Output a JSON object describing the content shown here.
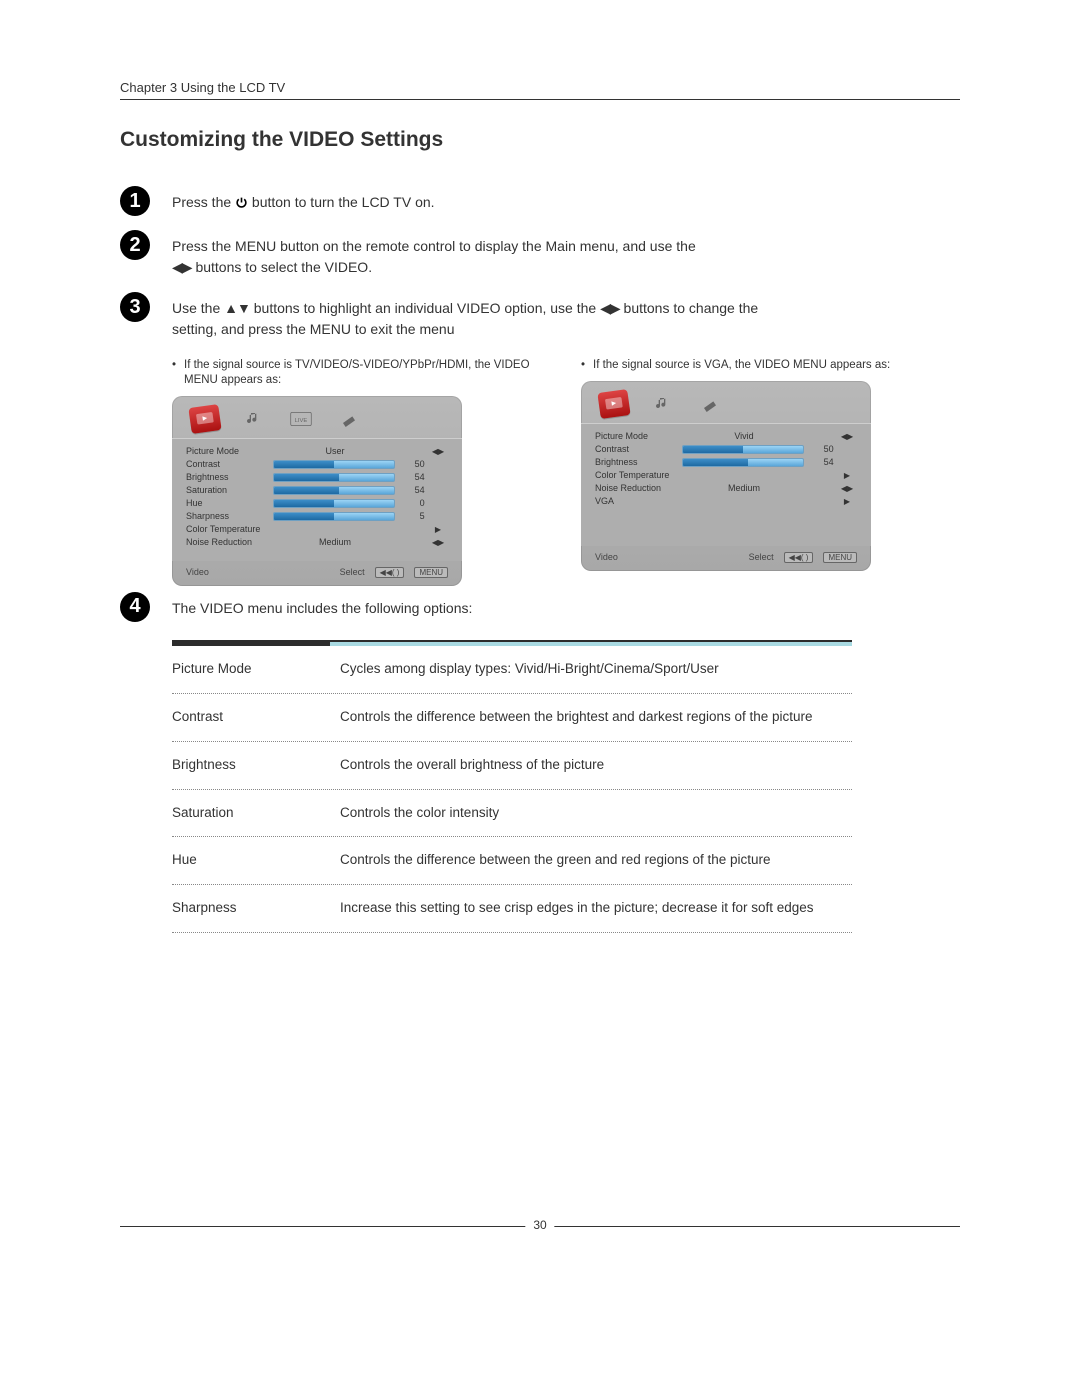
{
  "chapter_header": "Chapter 3 Using the LCD TV",
  "section_title": "Customizing the VIDEO Settings",
  "steps": {
    "s1_a": "Press the ",
    "s1_b": " button to turn the LCD TV on.",
    "s2_a": "Press the MENU button on the remote control to display the Main menu, and use the ",
    "s2_b": " buttons to select the VIDEO.",
    "s3_a": "Use the  ",
    "s3_b": " buttons to highlight an individual VIDEO option, use the ",
    "s3_c": " buttons to change the setting, and press the MENU to exit the menu",
    "s4": "The VIDEO menu includes the following options:"
  },
  "notes": {
    "left": "If the signal source is TV/VIDEO/S-VIDEO/YPbPr/HDMI, the VIDEO MENU appears as:",
    "right": "If the signal source is VGA, the VIDEO MENU appears as:"
  },
  "osd_left": {
    "rows": [
      {
        "label": "Picture Mode",
        "value": "User",
        "type": "text",
        "ind": "◀▶"
      },
      {
        "label": "Contrast",
        "value": "50",
        "type": "slider",
        "fill": 50,
        "ind": ""
      },
      {
        "label": "Brightness",
        "value": "54",
        "type": "slider",
        "fill": 54,
        "ind": ""
      },
      {
        "label": "Saturation",
        "value": "54",
        "type": "slider",
        "fill": 54,
        "ind": ""
      },
      {
        "label": "Hue",
        "value": "0",
        "type": "slider",
        "fill": 50,
        "ind": ""
      },
      {
        "label": "Sharpness",
        "value": "5",
        "type": "slider",
        "fill": 50,
        "ind": ""
      },
      {
        "label": "Color Temperature",
        "value": "",
        "type": "none",
        "ind": "▶"
      },
      {
        "label": "Noise Reduction",
        "value": "Medium",
        "type": "text",
        "ind": "◀▶"
      }
    ],
    "footer": {
      "left": "Video",
      "select": "Select",
      "center": "◀◀(  )",
      "menu": "MENU"
    }
  },
  "osd_right": {
    "rows": [
      {
        "label": "Picture Mode",
        "value": "Vivid",
        "type": "text",
        "ind": "◀▶"
      },
      {
        "label": "Contrast",
        "value": "50",
        "type": "slider",
        "fill": 50,
        "ind": ""
      },
      {
        "label": "Brightness",
        "value": "54",
        "type": "slider",
        "fill": 54,
        "ind": ""
      },
      {
        "label": "Color Temperature",
        "value": "",
        "type": "none",
        "ind": "▶"
      },
      {
        "label": "Noise Reduction",
        "value": "Medium",
        "type": "text",
        "ind": "◀▶"
      },
      {
        "label": "VGA",
        "value": "",
        "type": "none",
        "ind": "▶"
      }
    ],
    "footer": {
      "left": "Video",
      "select": "Select",
      "center": "◀◀(  )",
      "menu": "MENU"
    }
  },
  "options": [
    {
      "name": "Picture Mode",
      "desc": "Cycles among display types: Vivid/Hi-Bright/Cinema/Sport/User"
    },
    {
      "name": "Contrast",
      "desc": "Controls the difference between the brightest and darkest regions of the picture"
    },
    {
      "name": "Brightness",
      "desc": "Controls the overall brightness of the picture"
    },
    {
      "name": "Saturation",
      "desc": "Controls the color intensity"
    },
    {
      "name": "Hue",
      "desc": "Controls the difference between the green and red regions of the picture"
    },
    {
      "name": "Sharpness",
      "desc": "Increase this setting to see crisp edges in the picture; decrease it for soft edges"
    }
  ],
  "page_number": "30",
  "glyphs": {
    "lr": "◀▶",
    "ud": "▲▼"
  }
}
